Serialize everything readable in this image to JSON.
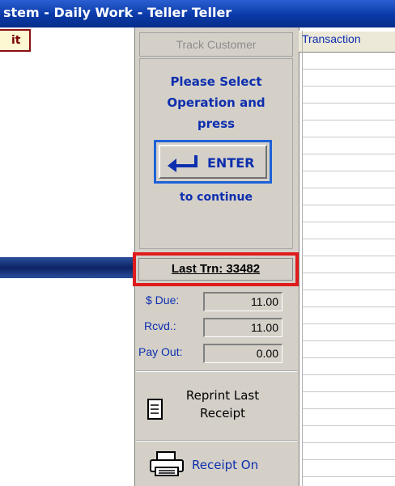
{
  "window": {
    "title": "stem - Daily Work - Teller Teller"
  },
  "toolbar": {
    "exit_label": "it",
    "track_customer_label": "Track Customer"
  },
  "instructions": {
    "line1": "Please Select",
    "line2": "Operation and",
    "line3": "press",
    "enter_label": "ENTER",
    "continue_label": "to continue"
  },
  "last_transaction": {
    "label": "Last Trn: 33482"
  },
  "fields": {
    "due_label": "$ Due:",
    "due_value": "11.00",
    "rcvd_label": "Rcvd.:",
    "rcvd_value": "11.00",
    "payout_label": "Pay Out:",
    "payout_value": "0.00"
  },
  "reprint": {
    "line1": "Reprint Last",
    "line2": "Receipt"
  },
  "receipt": {
    "label": "Receipt On"
  },
  "grid": {
    "header": "Transaction"
  },
  "colors": {
    "accent_blue": "#0d2eae",
    "highlight_red": "#e01b1b",
    "panel_gray": "#d4d0c8",
    "title_blue": "#0a3aa8"
  },
  "icons": {
    "enter": "enter-arrow-icon",
    "reprint": "document-icon",
    "printer": "printer-icon"
  }
}
